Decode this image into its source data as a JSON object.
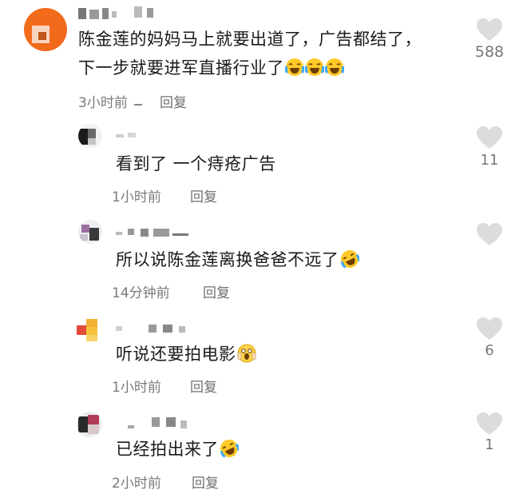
{
  "comments": [
    {
      "text": "陈金莲的妈妈马上就要出道了，广告都结了，",
      "text_line2": "下一步就要进军直播行业了",
      "emojis": [
        "laugh-cry-emoji",
        "laugh-cry-emoji",
        "laugh-cry-emoji"
      ],
      "time": "3小时前",
      "reply": "回复",
      "likes": "588",
      "avatar_color": "#f26a1b"
    },
    {
      "text": "看到了 一个痔疮广告",
      "time": "1小时前",
      "reply": "回复",
      "likes": "11"
    },
    {
      "text": "所以说陈金莲离换爸爸不远了",
      "emojis": [
        "rofl-emoji"
      ],
      "time": "14分钟前",
      "reply": "回复",
      "likes": ""
    },
    {
      "text": "听说还要拍电影",
      "emojis": [
        "shocked-emoji"
      ],
      "time": "1小时前",
      "reply": "回复",
      "likes": "6"
    },
    {
      "text": "已经拍出来了",
      "emojis": [
        "rofl-emoji"
      ],
      "time": "2小时前",
      "reply": "回复",
      "likes": "1"
    }
  ],
  "colors": {
    "heart": "#dcdcdc",
    "meta_text": "#7a7a7a"
  }
}
